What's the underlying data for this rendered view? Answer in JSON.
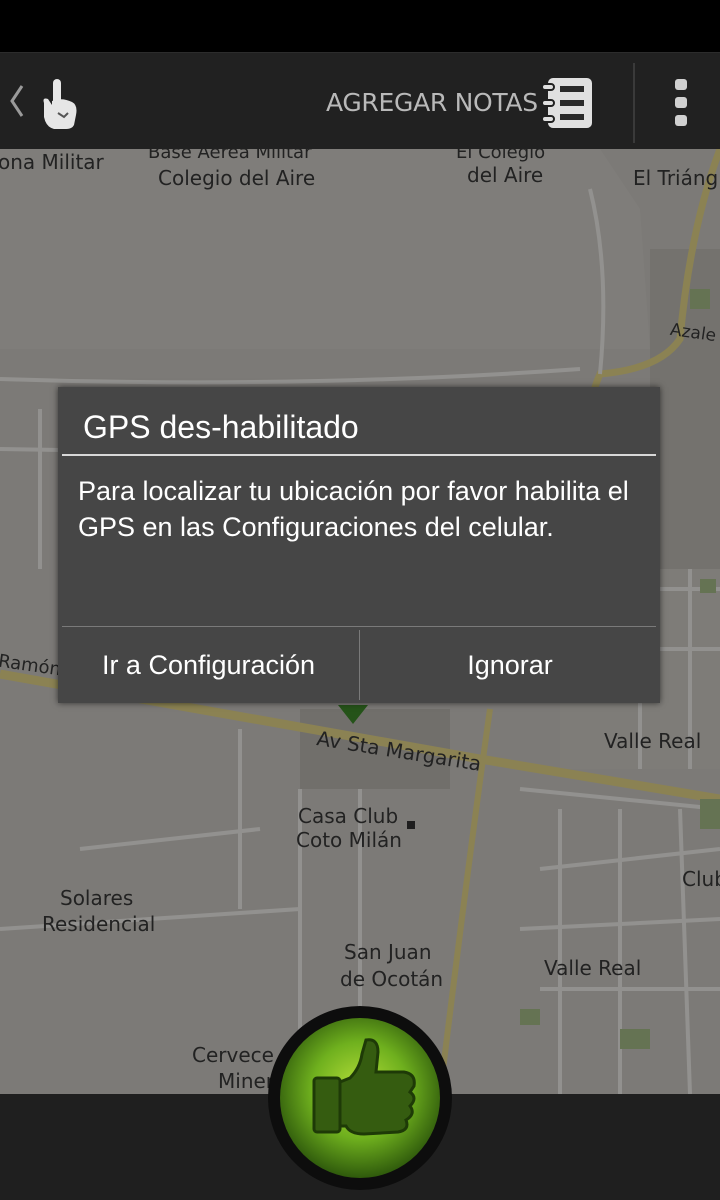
{
  "action_bar": {
    "back_icon": "chevron-left-icon",
    "app_icon": "pointing-hand-icon",
    "notes_label": "AGREGAR NOTAS",
    "notes_icon": "notebook-list-icon",
    "overflow_icon": "vertical-dots-icon"
  },
  "map": {
    "labels": [
      "ona Militar",
      "Base Aérea Militar",
      "Colegio del Aire",
      "El Colegio",
      "del Aire",
      "El Triáng",
      "Azale",
      "Ramón",
      "Av Sta Margarita",
      "Valle Real",
      "Casa Club",
      "Coto Milán",
      "Solares",
      "Residencial",
      "Club",
      "San Juan",
      "de Ocotán",
      "Valle Real",
      "Cervece",
      "Miner"
    ]
  },
  "dialog": {
    "title": "GPS des-habilitado",
    "message": "Para localizar tu ubicación por favor habilita el GPS en las Configuraciones del celular.",
    "button_settings": "Ir a Configuración",
    "button_ignore": "Ignorar"
  },
  "bottom": {
    "like_icon": "thumbs-up-icon"
  },
  "colors": {
    "accent_green": "#6fb01e",
    "dialog_bg": "#464646",
    "bar_bg": "#212121"
  }
}
